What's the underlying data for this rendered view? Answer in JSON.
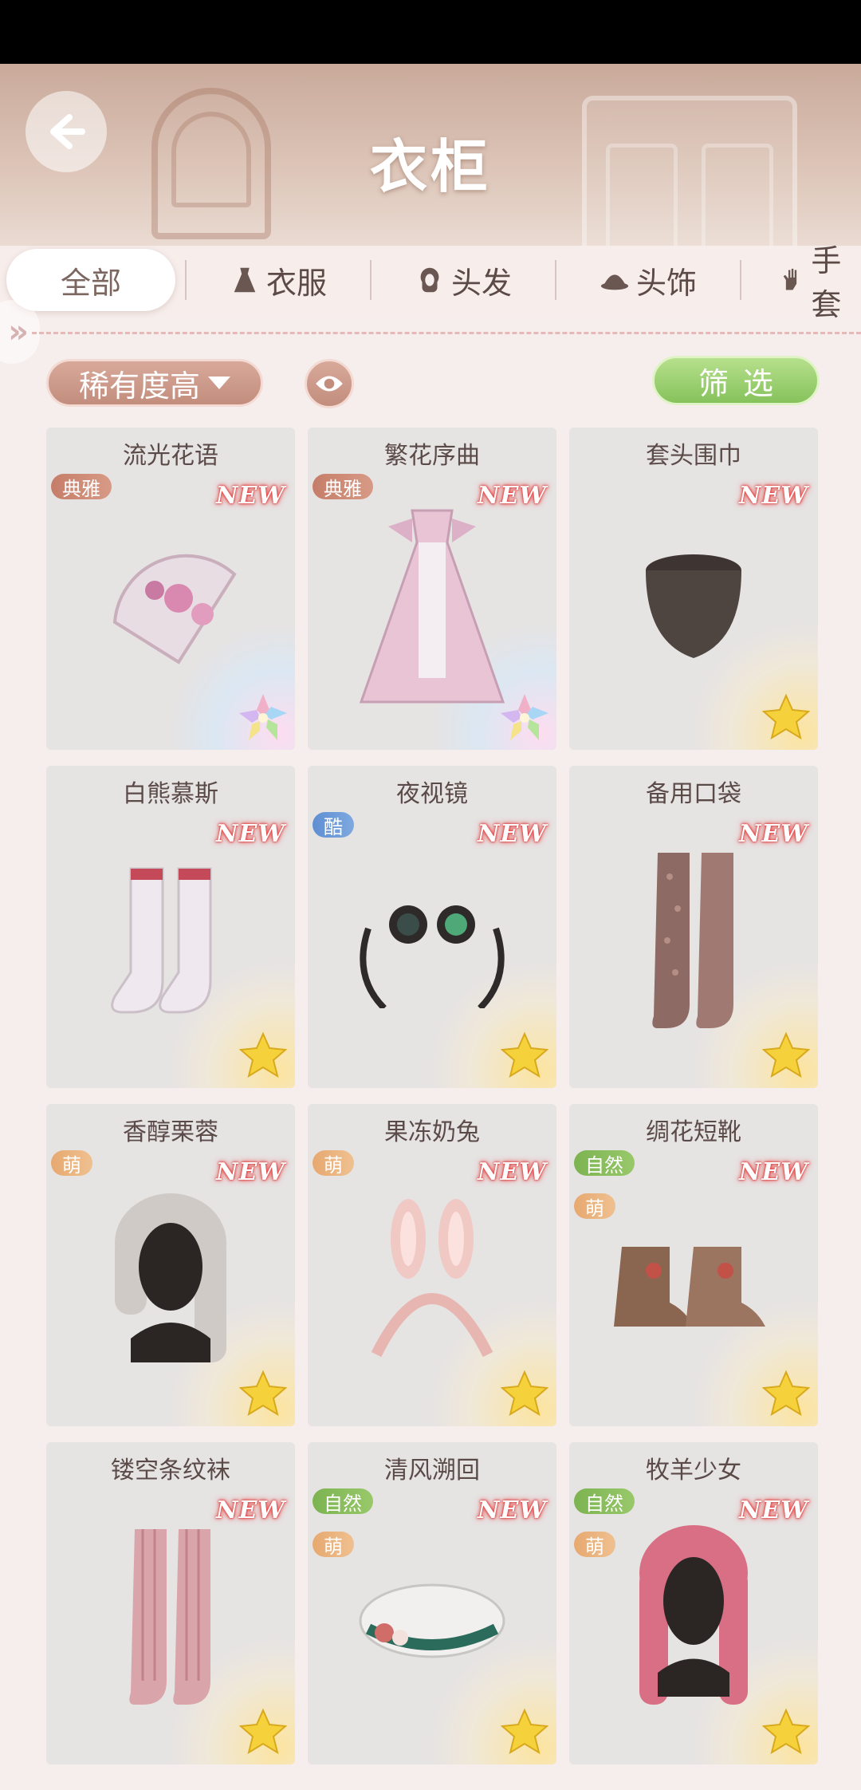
{
  "window": {
    "title": "衣柜"
  },
  "tabs": [
    {
      "label": "全部",
      "icon": "none",
      "active": true
    },
    {
      "label": "衣服",
      "icon": "dress-icon",
      "active": false
    },
    {
      "label": "头发",
      "icon": "hair-icon",
      "active": false
    },
    {
      "label": "头饰",
      "icon": "hat-icon",
      "active": false
    },
    {
      "label": "手套",
      "icon": "glove-icon",
      "active": false
    }
  ],
  "toolbar": {
    "sort_label": "稀有度高",
    "filter_label": "筛选"
  },
  "new_badge": "NEW",
  "items": [
    {
      "name": "流光花语",
      "tags": [
        "典雅"
      ],
      "new": true,
      "star": "rainbow",
      "kind": "fan-icon"
    },
    {
      "name": "繁花序曲",
      "tags": [
        "典雅"
      ],
      "new": true,
      "star": "rainbow",
      "kind": "dress-icon"
    },
    {
      "name": "套头围巾",
      "tags": [],
      "new": true,
      "star": "gold",
      "kind": "scarf-icon"
    },
    {
      "name": "白熊慕斯",
      "tags": [],
      "new": true,
      "star": "gold",
      "kind": "socks-icon"
    },
    {
      "name": "夜视镜",
      "tags": [
        "酷"
      ],
      "new": true,
      "star": "gold",
      "kind": "goggles-icon"
    },
    {
      "name": "备用口袋",
      "tags": [],
      "new": true,
      "star": "gold",
      "kind": "stockings-icon"
    },
    {
      "name": "香醇栗蓉",
      "tags": [
        "萌"
      ],
      "new": true,
      "star": "gold",
      "kind": "hair-icon"
    },
    {
      "name": "果冻奶兔",
      "tags": [
        "萌"
      ],
      "new": true,
      "star": "gold",
      "kind": "bunny-headband-icon"
    },
    {
      "name": "绸花短靴",
      "tags": [
        "自然",
        "萌"
      ],
      "new": true,
      "star": "gold",
      "kind": "boots-icon"
    },
    {
      "name": "镂空条纹袜",
      "tags": [],
      "new": true,
      "star": "gold",
      "kind": "striped-socks-icon"
    },
    {
      "name": "清风溯回",
      "tags": [
        "自然",
        "萌"
      ],
      "new": true,
      "star": "gold",
      "kind": "beret-icon"
    },
    {
      "name": "牧羊少女",
      "tags": [
        "自然",
        "萌"
      ],
      "new": true,
      "star": "gold",
      "kind": "pink-hair-icon"
    }
  ],
  "colors": {
    "accent_sort": "#c28d7d",
    "accent_filter": "#86c25c",
    "new_glow": "#e03a3a"
  }
}
